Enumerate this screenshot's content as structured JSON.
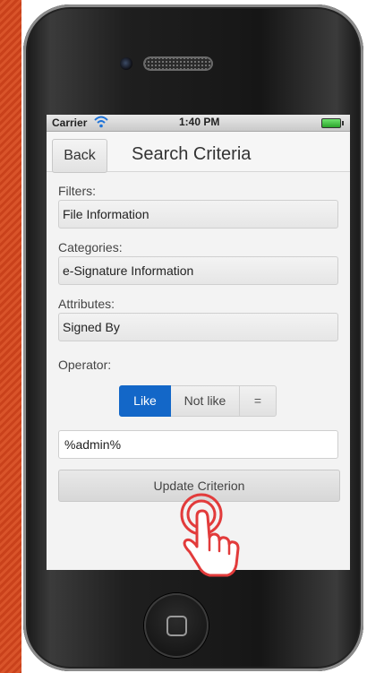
{
  "status_bar": {
    "carrier": "Carrier",
    "time": "1:40 PM",
    "icons": [
      "wifi-icon",
      "battery-icon"
    ]
  },
  "header": {
    "back_label": "Back",
    "title": "Search Criteria"
  },
  "form": {
    "filters": {
      "label": "Filters:",
      "value": "File Information"
    },
    "categories": {
      "label": "Categories:",
      "value": "e-Signature Information"
    },
    "attributes": {
      "label": "Attributes:",
      "value": "Signed By"
    },
    "operator": {
      "label": "Operator:",
      "options": [
        "Like",
        "Not like",
        "="
      ],
      "selected": "Like"
    },
    "value_input": "%admin%",
    "update_label": "Update Criterion"
  },
  "colors": {
    "accent": "#1367c8",
    "background_stripe": "#d24a22",
    "tap_indicator": "#e23b3b"
  }
}
